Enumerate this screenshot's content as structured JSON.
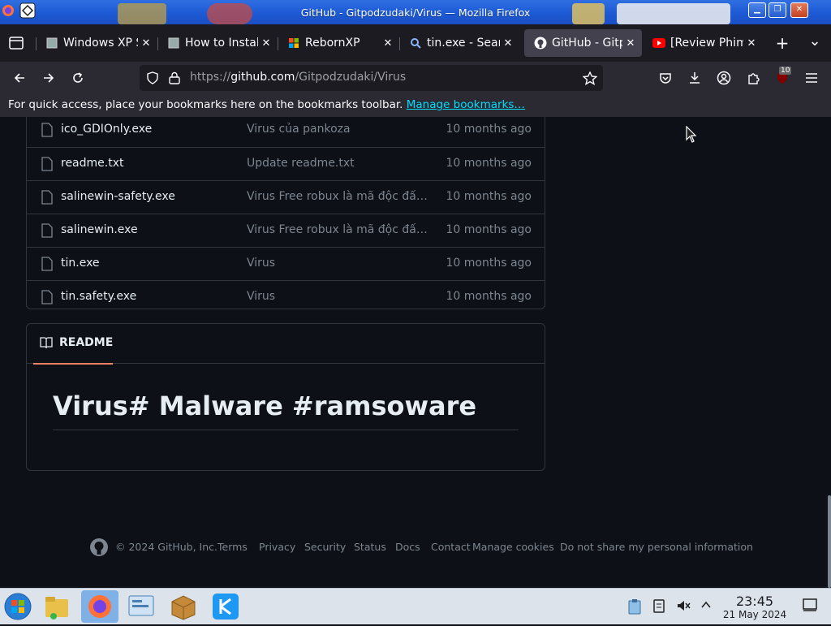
{
  "window": {
    "title": "GitHub - Gitpodzudaki/Virus — Mozilla Firefox",
    "min_label": "▁",
    "max_label": "❐",
    "close_label": "✕"
  },
  "tabs": [
    {
      "label": "Windows XP S",
      "icon": "page-icon",
      "active": false
    },
    {
      "label": "How to Install",
      "icon": "page-icon",
      "active": false
    },
    {
      "label": "RebornXP",
      "icon": "windows-flag-icon",
      "active": false
    },
    {
      "label": "tin.exe - Sear",
      "icon": "search-icon",
      "active": false
    },
    {
      "label": "GitHub - Gitpo",
      "icon": "github-icon",
      "active": true
    },
    {
      "label": "[Review Phim",
      "icon": "youtube-icon",
      "active": false
    }
  ],
  "tab_close_label": "✕",
  "new_tab_label": "+",
  "list_tabs_label": "⌄",
  "navbar": {
    "url_prefix": "https://",
    "url_domain": "github.com",
    "url_path": "/Gitpodzudaki/Virus",
    "extension_badge": "10"
  },
  "bookmarks_bar": {
    "text": "For quick access, place your bookmarks here on the bookmarks toolbar.",
    "link": "Manage bookmarks…"
  },
  "files": [
    {
      "name": "ico_GDIOnly.exe",
      "commit": "Virus của pankoza",
      "date": "10 months ago"
    },
    {
      "name": "readme.txt",
      "commit": "Update readme.txt",
      "date": "10 months ago"
    },
    {
      "name": "salinewin-safety.exe",
      "commit": "Virus Free robux là mã độc đấy.Đừng tải",
      "date": "10 months ago"
    },
    {
      "name": "salinewin.exe",
      "commit": "Virus Free robux là mã độc đấy.Đừng tải",
      "date": "10 months ago"
    },
    {
      "name": "tin.exe",
      "commit": "Virus",
      "date": "10 months ago"
    },
    {
      "name": "tin.safety.exe",
      "commit": "Virus",
      "date": "10 months ago"
    }
  ],
  "readme": {
    "tab_label": "README",
    "heading": "Virus# Malware #ramsoware"
  },
  "footer": {
    "copyright": "© 2024 GitHub, Inc.",
    "links": [
      "Terms",
      "Privacy",
      "Security",
      "Status",
      "Docs",
      "Contact",
      "Manage cookies",
      "Do not share my personal information"
    ]
  },
  "taskbar": {
    "time": "23:45",
    "date": "21 May 2024"
  },
  "colors": {
    "accent_underline": "#f78166",
    "link": "#00ddff",
    "page_bg": "#0d1117"
  }
}
